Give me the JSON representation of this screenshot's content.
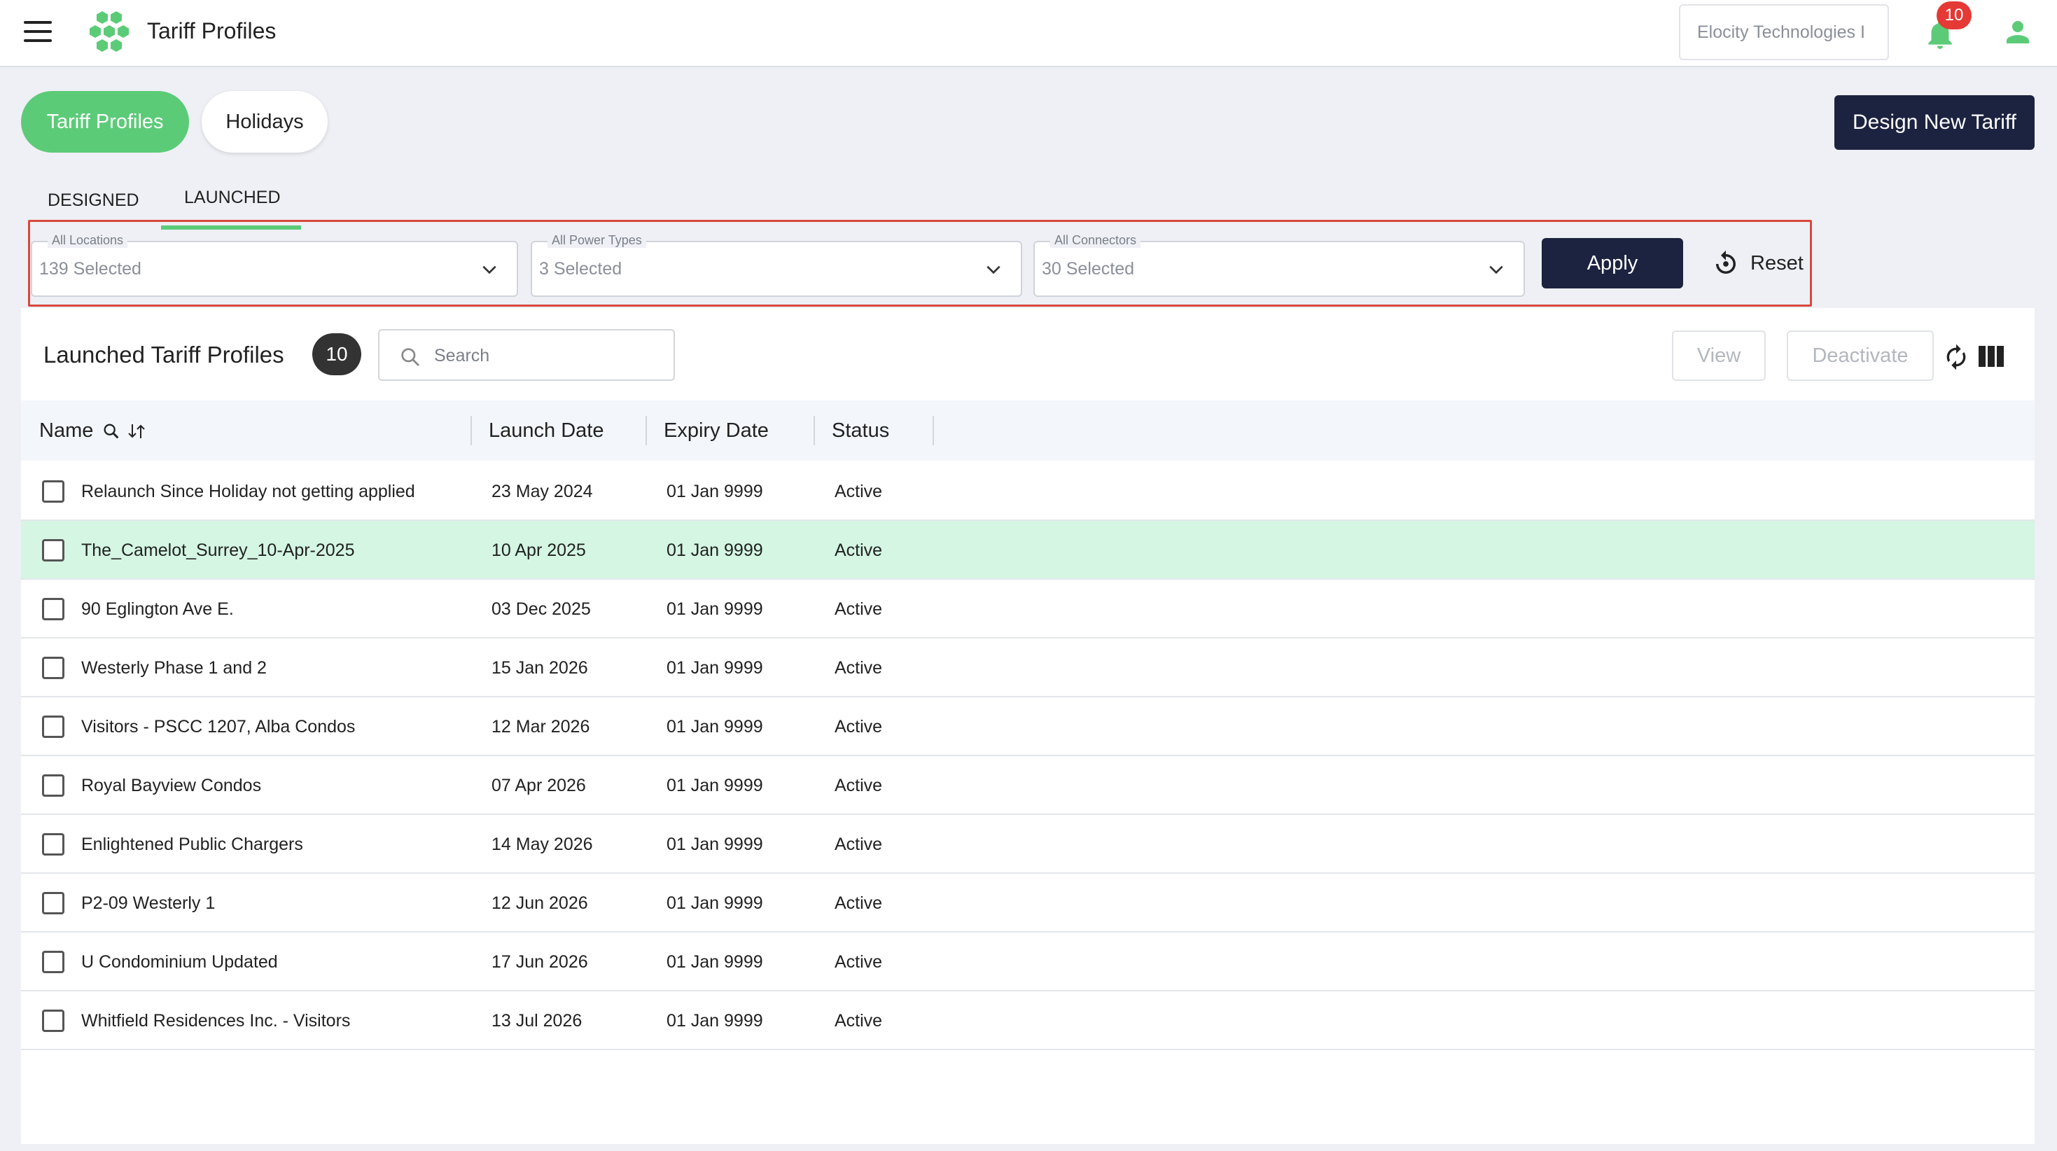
{
  "header": {
    "app_title": "Tariff Profiles",
    "organization": "Elocity Technologies I",
    "notification_count": "10",
    "brand_color": "#5ccb78"
  },
  "pills": {
    "tariff_profiles": "Tariff Profiles",
    "holidays": "Holidays"
  },
  "design_new_tariff": "Design New Tariff",
  "subtabs": {
    "designed": "DESIGNED",
    "launched": "LAUNCHED"
  },
  "filters": {
    "locations": {
      "label": "All Locations",
      "value": "139 Selected"
    },
    "power_types": {
      "label": "All Power Types",
      "value": "3 Selected"
    },
    "connectors": {
      "label": "All Connectors",
      "value": "30 Selected"
    },
    "apply": "Apply",
    "reset": "Reset"
  },
  "list": {
    "title": "Launched Tariff Profiles",
    "count": "10",
    "search_placeholder": "Search",
    "view": "View",
    "deactivate": "Deactivate"
  },
  "columns": {
    "name": "Name",
    "launch_date": "Launch Date",
    "expiry_date": "Expiry Date",
    "status": "Status"
  },
  "rows": [
    {
      "name": "Relaunch Since Holiday not getting applied",
      "launch": "23 May 2024",
      "expiry": "01 Jan 9999",
      "status": "Active"
    },
    {
      "name": "The_Camelot_Surrey_10-Apr-2025",
      "launch": "10 Apr 2025",
      "expiry": "01 Jan 9999",
      "status": "Active"
    },
    {
      "name": "90 Eglington Ave E.",
      "launch": "03 Dec 2025",
      "expiry": "01 Jan 9999",
      "status": "Active"
    },
    {
      "name": "Westerly Phase 1 and 2",
      "launch": "15 Jan 2026",
      "expiry": "01 Jan 9999",
      "status": "Active"
    },
    {
      "name": "Visitors - PSCC 1207, Alba Condos",
      "launch": "12 Mar 2026",
      "expiry": "01 Jan 9999",
      "status": "Active"
    },
    {
      "name": "Royal Bayview Condos",
      "launch": "07 Apr 2026",
      "expiry": "01 Jan 9999",
      "status": "Active"
    },
    {
      "name": "Enlightened Public Chargers",
      "launch": "14 May 2026",
      "expiry": "01 Jan 9999",
      "status": "Active"
    },
    {
      "name": "P2-09 Westerly 1",
      "launch": "12 Jun 2026",
      "expiry": "01 Jan 9999",
      "status": "Active"
    },
    {
      "name": "U Condominium Updated",
      "launch": "17 Jun 2026",
      "expiry": "01 Jan 9999",
      "status": "Active"
    },
    {
      "name": "Whitfield Residences Inc. - Visitors",
      "launch": "13 Jul 2026",
      "expiry": "01 Jan 9999",
      "status": "Active"
    }
  ]
}
